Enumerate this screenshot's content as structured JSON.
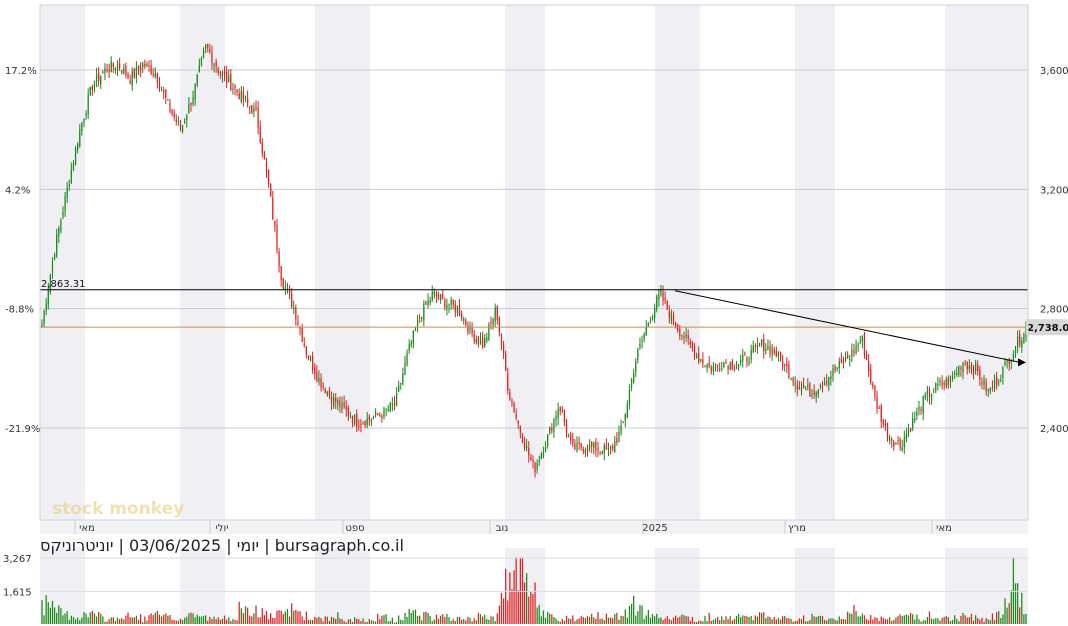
{
  "chart_data": {
    "type": "candlestick",
    "caption": "יומי | 03/06/2025 | יוניטרוניקס | bursagraph.co.il",
    "watermark": "stock monkey",
    "y_right_ticks": [
      "3,600",
      "3,200",
      "2,800",
      "2,400"
    ],
    "y_right_tick_values": [
      3600,
      3200,
      2800,
      2400
    ],
    "y_left_ticks": [
      "17.2%",
      "4.2%",
      "-8.8%",
      "-21.9%"
    ],
    "x_month_labels": [
      "מאי",
      "יולי",
      "ספט",
      "נוב",
      "2025",
      "מרץ",
      "מאי"
    ],
    "y_range": [
      2200,
      3700
    ],
    "reference_level": {
      "label": "2,863.31",
      "value": 2863.31
    },
    "last_price": {
      "label": "2,738.00",
      "value": 2738
    },
    "trendline": {
      "start_value": 2860,
      "end_value": 2620
    },
    "volume_ticks": [
      "3,267",
      "1,615"
    ],
    "volume_tick_values": [
      3267,
      1615
    ],
    "colors": {
      "up": "#1a8a1a",
      "down": "#e02020",
      "ref_line": "#000000",
      "price_line": "#d08a40",
      "band": "#f0f0f4"
    },
    "price_path": [
      2750,
      3000,
      3200,
      3400,
      3550,
      3600,
      3620,
      3570,
      3620,
      3590,
      3480,
      3400,
      3520,
      3680,
      3600,
      3550,
      3500,
      3450,
      3200,
      2900,
      2800,
      2650,
      2560,
      2500,
      2460,
      2420,
      2430,
      2450,
      2480,
      2650,
      2780,
      2850,
      2820,
      2800,
      2720,
      2680,
      2800,
      2520,
      2380,
      2260,
      2360,
      2480,
      2330,
      2340,
      2330,
      2320,
      2400,
      2620,
      2750,
      2850,
      2760,
      2700,
      2640,
      2600,
      2620,
      2610,
      2640,
      2680,
      2660,
      2600,
      2540,
      2520,
      2560,
      2600,
      2640,
      2700,
      2500,
      2380,
      2340,
      2420,
      2500,
      2540,
      2560,
      2620,
      2600,
      2520,
      2580,
      2660,
      2738
    ],
    "volume_path": [
      1400,
      900,
      600,
      500,
      700,
      300,
      400,
      500,
      300,
      600,
      400,
      300,
      700,
      400,
      300,
      500,
      700,
      900,
      500,
      600,
      1000,
      500,
      300,
      400,
      200,
      300,
      300,
      500,
      200,
      800,
      600,
      400,
      500,
      300,
      300,
      600,
      400,
      2900,
      3267,
      1200,
      600,
      300,
      400,
      300,
      600,
      400,
      800,
      900,
      700,
      500,
      600,
      400,
      300,
      500,
      300,
      400,
      500,
      600,
      300,
      400,
      300,
      500,
      400,
      300,
      900,
      600,
      400,
      300,
      500,
      600,
      300,
      400,
      300,
      500,
      400,
      300,
      800,
      3000,
      700
    ]
  }
}
